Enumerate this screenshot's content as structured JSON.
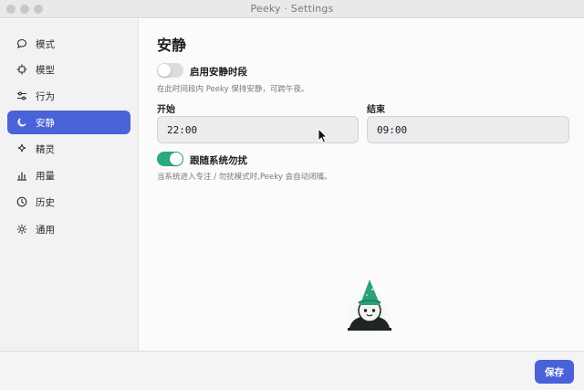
{
  "window": {
    "title": "Peeky · Settings"
  },
  "sidebar": {
    "items": [
      {
        "label": "模式",
        "icon": "chat-bubble-icon",
        "active": false
      },
      {
        "label": "模型",
        "icon": "chip-icon",
        "active": false
      },
      {
        "label": "行为",
        "icon": "sliders-icon",
        "active": false
      },
      {
        "label": "安静",
        "icon": "moon-icon",
        "active": true
      },
      {
        "label": "精灵",
        "icon": "sparkle-icon",
        "active": false
      },
      {
        "label": "用量",
        "icon": "bar-chart-icon",
        "active": false
      },
      {
        "label": "历史",
        "icon": "clock-icon",
        "active": false
      },
      {
        "label": "通用",
        "icon": "gear-icon",
        "active": false
      }
    ]
  },
  "main": {
    "title": "安静",
    "quiet_hours": {
      "label": "启用安静时段",
      "enabled": false,
      "help": "在此时间段内 Peeky 保持安静，可跨午夜。"
    },
    "start": {
      "label": "开始",
      "value": "22:00"
    },
    "end": {
      "label": "结束",
      "value": "09:00"
    },
    "follow_system": {
      "label": "跟随系统勿扰",
      "enabled": true,
      "help": "当系统进入专注 / 勿扰模式时,Peeky 会自动闭嘴。"
    }
  },
  "footer": {
    "save_label": "保存"
  },
  "colors": {
    "accent": "#4a62d8",
    "toggle_on": "#2bab79",
    "toggle_off": "#dcdce0",
    "sidebar_bg": "#f2f2f4"
  }
}
